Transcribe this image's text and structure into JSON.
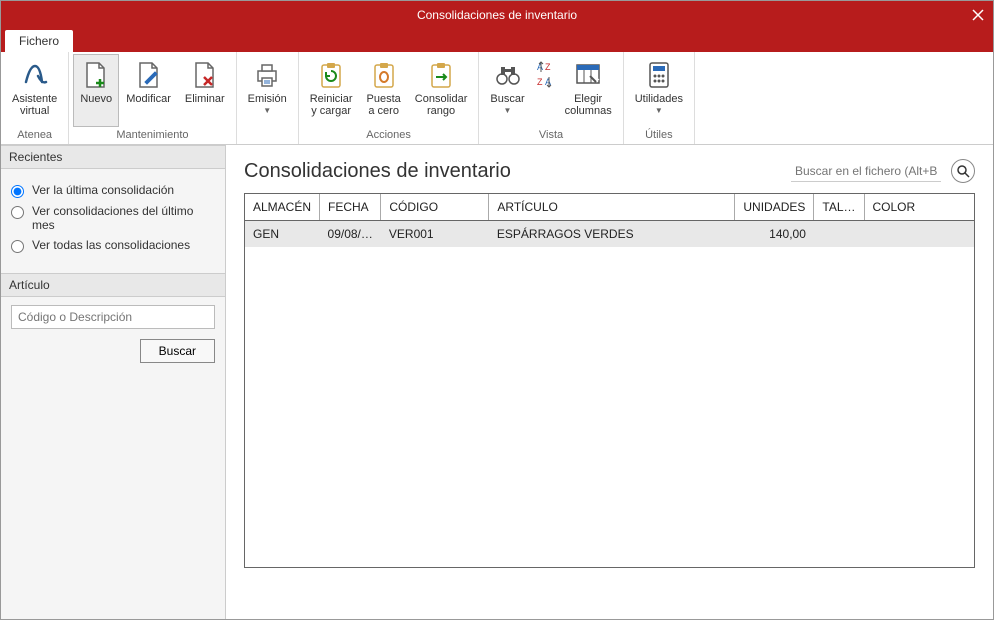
{
  "window": {
    "title": "Consolidaciones de inventario"
  },
  "tabs": {
    "fichero": "Fichero"
  },
  "ribbon": {
    "atenea": {
      "label": "Atenea",
      "asistente": "Asistente\nvirtual"
    },
    "mantenimiento": {
      "label": "Mantenimiento",
      "nuevo": "Nuevo",
      "modificar": "Modificar",
      "eliminar": "Eliminar"
    },
    "emision": {
      "label": "",
      "emision": "Emisión"
    },
    "acciones": {
      "label": "Acciones",
      "reiniciar": "Reiniciar\ny cargar",
      "puesta": "Puesta\na cero",
      "consolidar": "Consolidar\nrango"
    },
    "vista": {
      "label": "Vista",
      "buscar": "Buscar",
      "elegir": "Elegir\ncolumnas"
    },
    "utiles": {
      "label": "Útiles",
      "utilidades": "Utilidades"
    }
  },
  "sidebar": {
    "recientes": {
      "head": "Recientes",
      "opt1": "Ver la última consolidación",
      "opt2": "Ver consolidaciones del último mes",
      "opt3": "Ver todas las consolidaciones"
    },
    "articulo": {
      "head": "Artículo",
      "placeholder": "Código o Descripción",
      "buscar": "Buscar"
    }
  },
  "main": {
    "title": "Consolidaciones de inventario",
    "search_placeholder": "Buscar en el fichero (Alt+B)",
    "columns": {
      "almacen": "ALMACÉN",
      "fecha": "FECHA",
      "codigo": "CÓDIGO",
      "articulo": "ARTÍCULO",
      "unidades": "UNIDADES",
      "talla": "TAL…",
      "color": "COLOR"
    },
    "rows": [
      {
        "almacen": "GEN",
        "fecha": "09/08/…",
        "codigo": "VER001",
        "articulo": "ESPÁRRAGOS VERDES",
        "unidades": "140,00",
        "talla": "",
        "color": ""
      }
    ]
  }
}
